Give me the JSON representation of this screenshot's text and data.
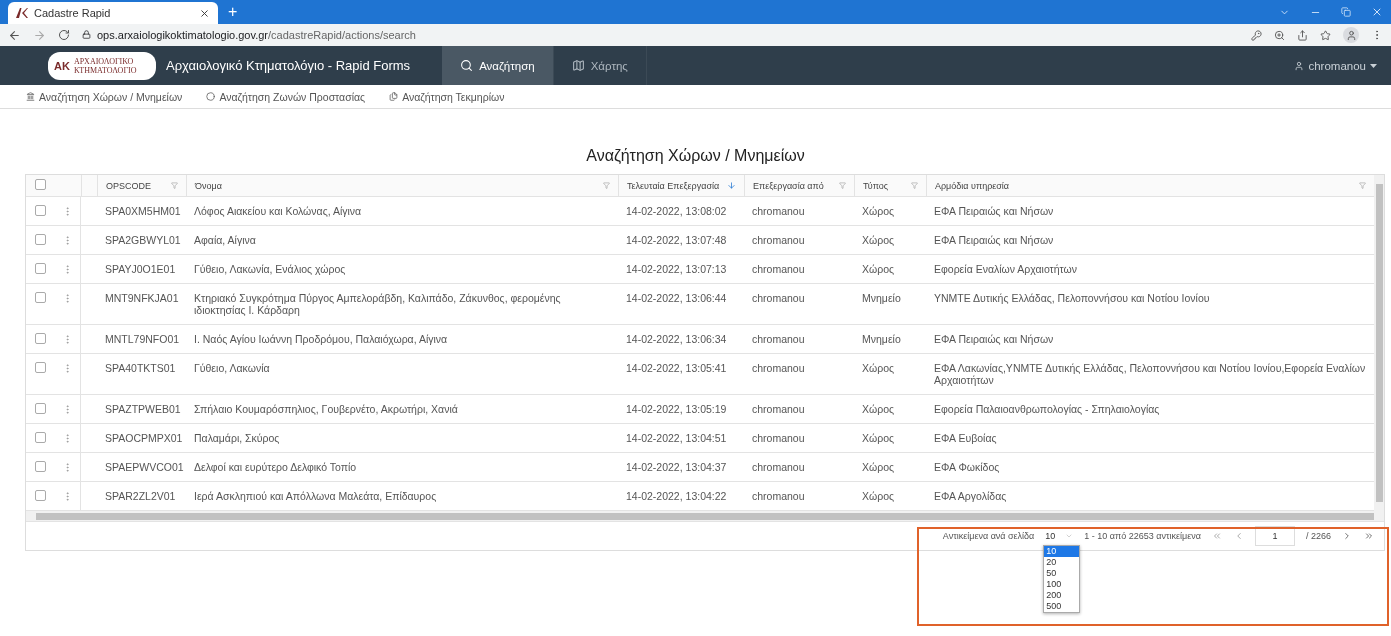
{
  "browser": {
    "tab_title": "Cadastre Rapid",
    "new_tab": "+",
    "url_host": "ops.arxaiologikoktimatologio.gov.gr",
    "url_path": "/cadastreRapid/actions/search"
  },
  "app": {
    "logo_mark": "ΑΚ",
    "logo_line1": "ΑΡΧΑΙΟΛΟΓΙΚΟ",
    "logo_line2": "ΚΤΗΜΑΤΟΛΟΓΙΟ",
    "title": "Αρχαιολογικό Κτηματολόγιο - Rapid Forms",
    "nav": [
      {
        "kind": "search",
        "label": "Αναζήτηση",
        "selected": true
      },
      {
        "kind": "map",
        "label": "Χάρτης",
        "selected": false
      }
    ],
    "user": "chromanou"
  },
  "subnav": [
    {
      "kind": "sites",
      "label": "Αναζήτηση Χώρων / Μνημείων"
    },
    {
      "kind": "zones",
      "label": "Αναζήτηση Ζωνών Προστασίας"
    },
    {
      "kind": "evidence",
      "label": "Αναζήτηση Τεκμηρίων"
    }
  ],
  "page_title": "Αναζήτηση Χώρων / Μνημείων",
  "table": {
    "select_all_checked": false,
    "columns": [
      {
        "label": "OPSCODE",
        "sorted_descending": false
      },
      {
        "label": "Όνομα",
        "sorted_descending": false
      },
      {
        "label": "Τελευταία Επεξεργασία",
        "sorted_descending": true
      },
      {
        "label": "Επεξεργασία από",
        "sorted_descending": false
      },
      {
        "label": "Τύπος",
        "sorted_descending": false
      },
      {
        "label": "Αρμόδια υπηρεσία",
        "sorted_descending": false
      }
    ],
    "rows": [
      {
        "checked": false,
        "cells": [
          "SPA0XM5HM01",
          "Λόφος Αιακείου και Κολώνας, Αίγινα",
          "14-02-2022, 13:08:02",
          "chromanou",
          "Χώρος",
          "ΕΦΑ Πειραιώς και Νήσων"
        ]
      },
      {
        "checked": false,
        "cells": [
          "SPA2GBWYL01",
          "Αφαία, Αίγινα",
          "14-02-2022, 13:07:48",
          "chromanou",
          "Χώρος",
          "ΕΦΑ Πειραιώς και Νήσων"
        ]
      },
      {
        "checked": false,
        "cells": [
          "SPAYJ0O1E01",
          "Γύθειο, Λακωνία, Ενάλιος χώρος",
          "14-02-2022, 13:07:13",
          "chromanou",
          "Χώρος",
          "Εφορεία Εναλίων Αρχαιοτήτων"
        ]
      },
      {
        "checked": false,
        "cells": [
          "MNT9NFKJA01",
          "Κτηριακό Συγκρότημα Πύργος Αμπελοράβδη, Καλιπάδο, Ζάκυνθος, φερομένης ιδιοκτησίας Ι. Κάρδαρη",
          "14-02-2022, 13:06:44",
          "chromanou",
          "Μνημείο",
          "ΥΝΜΤΕ Δυτικής Ελλάδας, Πελοποννήσου και Νοτίου Ιονίου"
        ]
      },
      {
        "checked": false,
        "cells": [
          "MNTL79NFO01",
          "Ι. Ναός Αγίου Ιωάννη Προδρόμου, Παλαιόχωρα, Αίγινα",
          "14-02-2022, 13:06:34",
          "chromanou",
          "Μνημείο",
          "ΕΦΑ Πειραιώς και Νήσων"
        ]
      },
      {
        "checked": false,
        "cells": [
          "SPA40TKTS01",
          "Γύθειο, Λακωνία",
          "14-02-2022, 13:05:41",
          "chromanou",
          "Χώρος",
          "ΕΦΑ Λακωνίας,ΥΝΜΤΕ Δυτικής Ελλάδας, Πελοποννήσου και Νοτίου Ιονίου,Εφορεία Εναλίων Αρχαιοτήτων"
        ]
      },
      {
        "checked": false,
        "cells": [
          "SPAZTPWEB01",
          "Σπήλαιο Κουμαρόσπηλιος, Γουβερνέτο, Ακρωτήρι, Χανιά",
          "14-02-2022, 13:05:19",
          "chromanou",
          "Χώρος",
          "Εφορεία Παλαιοανθρωπολογίας - Σπηλαιολογίας"
        ]
      },
      {
        "checked": false,
        "cells": [
          "SPAOCPMPX01",
          "Παλαμάρι, Σκύρος",
          "14-02-2022, 13:04:51",
          "chromanou",
          "Χώρος",
          "ΕΦΑ Ευβοίας"
        ]
      },
      {
        "checked": false,
        "cells": [
          "SPAEPWVCO01",
          "Δελφοί και ευρύτερο Δελφικό Τοπίο",
          "14-02-2022, 13:04:37",
          "chromanou",
          "Χώρος",
          "ΕΦΑ Φωκίδος"
        ]
      },
      {
        "checked": false,
        "cells": [
          "SPAR2ZL2V01",
          "Ιερά Ασκληπιού και Απόλλωνα Μαλεάτα, Επίδαυρος",
          "14-02-2022, 13:04:22",
          "chromanou",
          "Χώρος",
          "ΕΦΑ Αργολίδας"
        ]
      }
    ]
  },
  "pager": {
    "per_page_label": "Αντικείμενα ανά σελίδα",
    "per_page_value": "10",
    "per_page_open": true,
    "per_page_options": [
      {
        "label": "10",
        "selected": true
      },
      {
        "label": "20",
        "selected": false
      },
      {
        "label": "50",
        "selected": false
      },
      {
        "label": "100",
        "selected": false
      },
      {
        "label": "200",
        "selected": false
      },
      {
        "label": "500",
        "selected": false
      }
    ],
    "range": "1 - 10 από 22653 αντικείμενα",
    "page": "1",
    "total": "/ 2266"
  }
}
